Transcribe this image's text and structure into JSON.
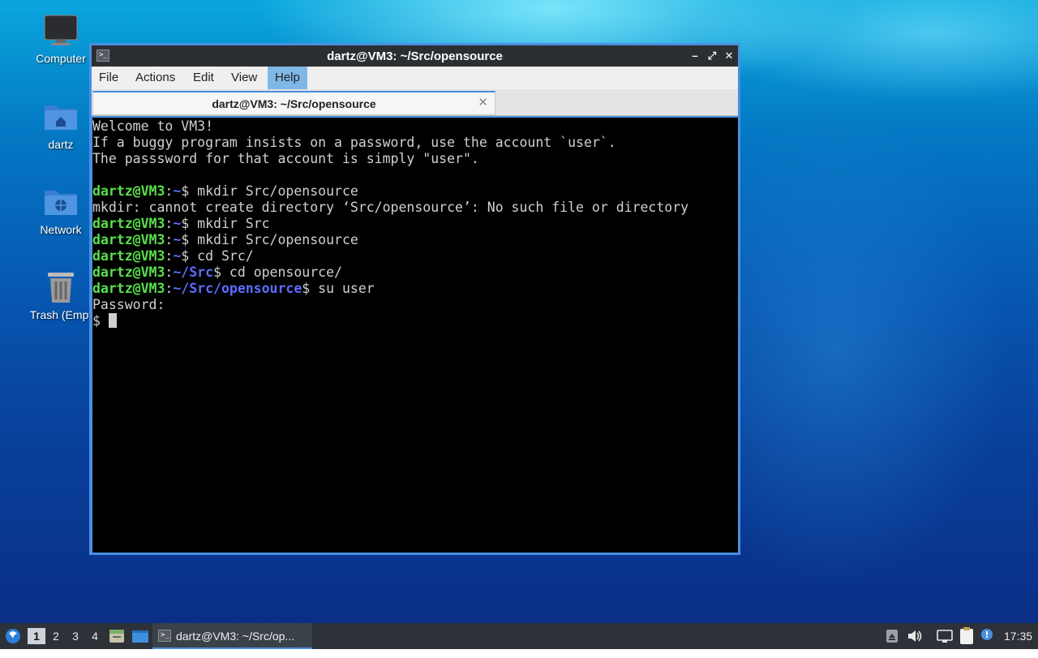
{
  "desktop": {
    "icons": [
      {
        "label": "Computer"
      },
      {
        "label": "dartz"
      },
      {
        "label": "Network"
      },
      {
        "label": "Trash (Empt"
      }
    ]
  },
  "window": {
    "title": "dartz@VM3: ~/Src/opensource",
    "title_icon": ">_",
    "buttons": {
      "minimize": "–",
      "maximize": "⤢",
      "close": "✕"
    },
    "menu": [
      "File",
      "Actions",
      "Edit",
      "View",
      "Help"
    ],
    "menu_active": "Help",
    "tab": {
      "title": "dartz@VM3: ~/Src/opensource",
      "close": "✕"
    }
  },
  "terminal": {
    "welcome": [
      "Welcome to VM3!",
      "If a buggy program insists on a password, use the account `user`.",
      "The passsword for that account is simply \"user\"."
    ],
    "prompt_user": "dartz@VM3",
    "history": [
      {
        "path": "~",
        "cmd": " mkdir Src/opensource"
      },
      {
        "output": "mkdir: cannot create directory ‘Src/opensource’: No such file or directory"
      },
      {
        "path": "~",
        "cmd": " mkdir Src"
      },
      {
        "path": "~",
        "cmd": " mkdir Src/opensource"
      },
      {
        "path": "~",
        "cmd": " cd Src/"
      },
      {
        "path": "~/Src",
        "cmd": " cd opensource/"
      },
      {
        "path": "~/Src/opensource",
        "cmd": " su user"
      }
    ],
    "password_prompt": "Password:",
    "current_prompt": "$ "
  },
  "taskbar": {
    "workspaces": [
      "1",
      "2",
      "3",
      "4"
    ],
    "active_workspace": "1",
    "task_label": "dartz@VM3: ~/Src/op...",
    "clock": "17:35",
    "icons": [
      "start-menu-icon",
      "file-manager-icon",
      "show-desktop-icon",
      "terminal-icon",
      "eject-icon",
      "volume-icon",
      "network-icon",
      "clipboard-icon",
      "update-notifier-icon"
    ]
  },
  "colors": {
    "prompt_user": "#58e04a",
    "prompt_path": "#5c6cff",
    "window_border": "#4a8fe0",
    "titlebar": "#2b2e33"
  }
}
